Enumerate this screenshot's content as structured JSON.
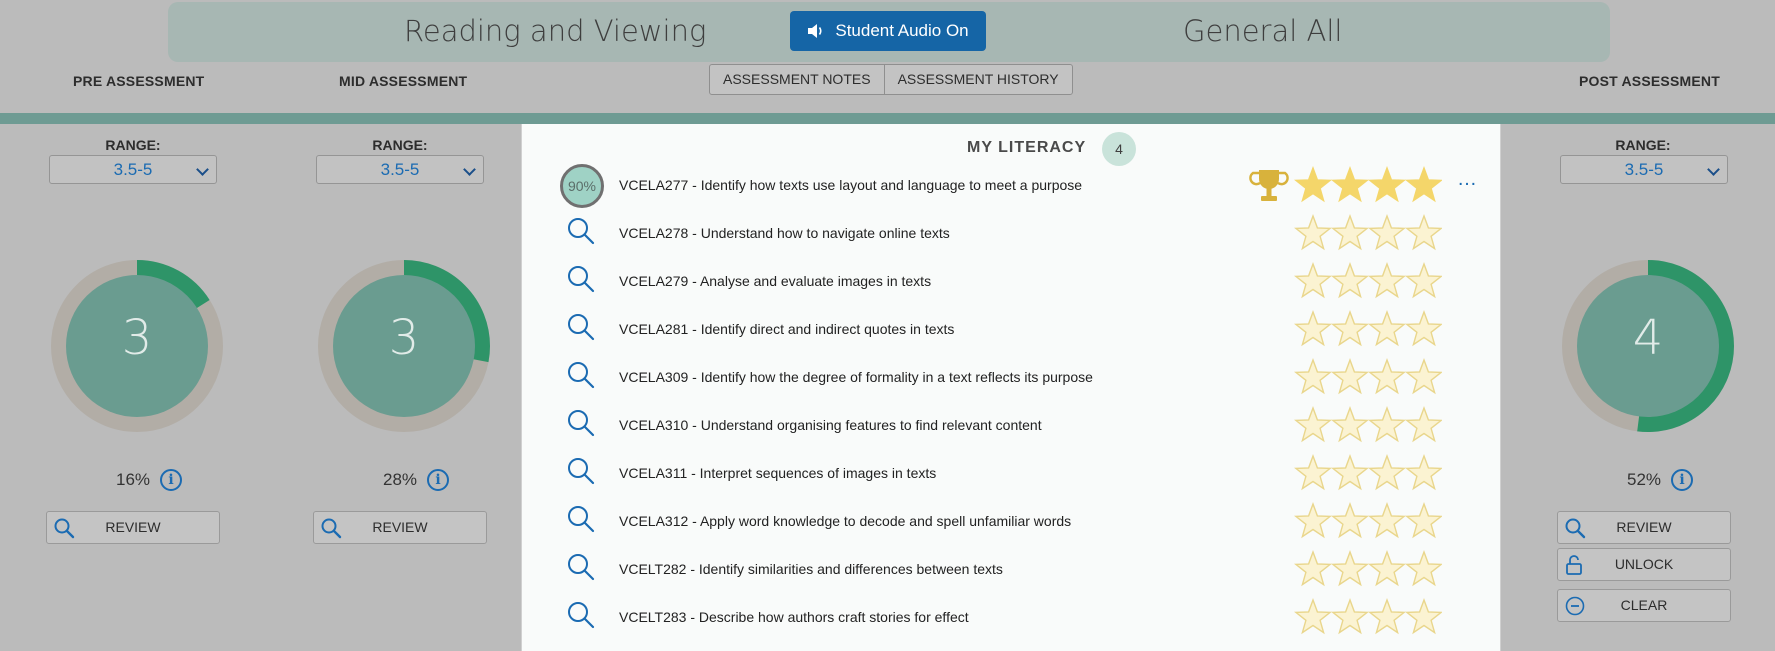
{
  "header": {
    "subject_left": "Reading and Viewing",
    "audio_button": "Student Audio On",
    "subject_right": "General All"
  },
  "assessments": {
    "pre": {
      "label": "PRE ASSESSMENT",
      "range_label": "RANGE:",
      "range_value": "3.5-5",
      "level": "3",
      "percent": "16%",
      "progress": 0.16,
      "review": "REVIEW"
    },
    "mid": {
      "label": "MID ASSESSMENT",
      "range_label": "RANGE:",
      "range_value": "3.5-5",
      "level": "3",
      "percent": "28%",
      "progress": 0.28,
      "review": "REVIEW"
    },
    "post": {
      "label": "POST ASSESSMENT",
      "range_label": "RANGE:",
      "range_value": "3.5-5",
      "level": "4",
      "percent": "52%",
      "progress": 0.52,
      "review": "REVIEW",
      "unlock": "UNLOCK",
      "clear": "CLEAR"
    }
  },
  "tabs": {
    "notes": "ASSESSMENT NOTES",
    "history": "ASSESSMENT HISTORY"
  },
  "panel": {
    "title": "MY LITERACY",
    "badge": "4",
    "first_mastery": "90%",
    "items": [
      {
        "text": "VCELA277 - Identify how texts use layout and language to meet a purpose",
        "stars": 4
      },
      {
        "text": "VCELA278 - Understand how to navigate online texts",
        "stars": 0
      },
      {
        "text": "VCELA279 - Analyse and evaluate images in texts",
        "stars": 0
      },
      {
        "text": "VCELA281 - Identify direct and indirect quotes in texts",
        "stars": 0
      },
      {
        "text": "VCELA309 - Identify how the degree of formality in a text reflects its purpose",
        "stars": 0
      },
      {
        "text": "VCELA310 - Understand organising features to find relevant content",
        "stars": 0
      },
      {
        "text": "VCELA311 - Interpret sequences of images in texts",
        "stars": 0
      },
      {
        "text": "VCELA312 - Apply word knowledge to decode and spell unfamiliar words",
        "stars": 0
      },
      {
        "text": "VCELT282 - Identify similarities and differences between texts",
        "stars": 0
      },
      {
        "text": "VCELT283 - Describe how authors craft stories for effect",
        "stars": 0
      }
    ]
  },
  "colors": {
    "gauge_track": "#b2ada6",
    "gauge_fill": "#2e9468",
    "gauge_inner": "#6a9c90",
    "star_filled": "#f4d66a",
    "star_empty": "#fbf3d2",
    "star_outline": "#e9d68c",
    "accent": "#1565a6"
  },
  "icons": {
    "audio": "speaker-icon",
    "search": "magnifier-icon",
    "info": "info-icon",
    "chevron": "chevron-down-icon",
    "trophy": "trophy-icon",
    "lock": "unlocked-padlock-icon",
    "clear": "minus-circle-icon",
    "more": "ellipsis-icon"
  }
}
